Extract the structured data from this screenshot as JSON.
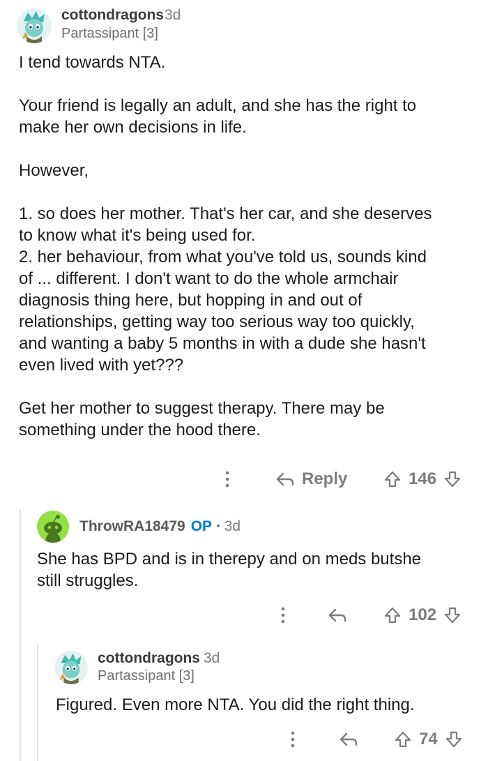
{
  "comments": [
    {
      "username": "cottondragons",
      "age": "3d",
      "flair": "Partassipant [3]",
      "body": "I tend towards NTA.\n\nYour friend is legally an adult, and she has the right to\nmake her own decisions in life.\n\nHowever,\n\n1. so does her mother. That's her car, and she deserves\nto know what it's being used for.\n2. her behaviour, from what you've told us, sounds kind\nof ... different. I don't want to do the whole armchair\ndiagnosis thing here, but hopping in and out of\nrelationships, getting way too serious way too quickly,\nand wanting a baby 5 months in with a dude she hasn't\neven lived with yet???\n\nGet her mother to suggest therapy. There may be\nsomething under the hood there.",
      "reply_label": "Reply",
      "score": "146"
    },
    {
      "username": "ThrowRA18479",
      "op_badge": "OP",
      "separator": "•",
      "age": "3d",
      "body": "She has BPD and is in therepy and on meds butshe\nstill struggles.",
      "score": "102"
    },
    {
      "username": "cottondragons",
      "age": "3d",
      "flair": "Partassipant [3]",
      "body": "Figured. Even more NTA. You did the right thing.",
      "score": "74"
    }
  ],
  "icons": [
    "dragon-avatar-icon",
    "snoo-avatar-icon",
    "more-options-icon",
    "reply-arrow-icon",
    "upvote-icon",
    "downvote-icon"
  ],
  "colors": {
    "op": "#0079d3",
    "muted": "#7c7c7c",
    "thread_line": "#e3e3e3",
    "snoo_bg": "#94e044"
  }
}
